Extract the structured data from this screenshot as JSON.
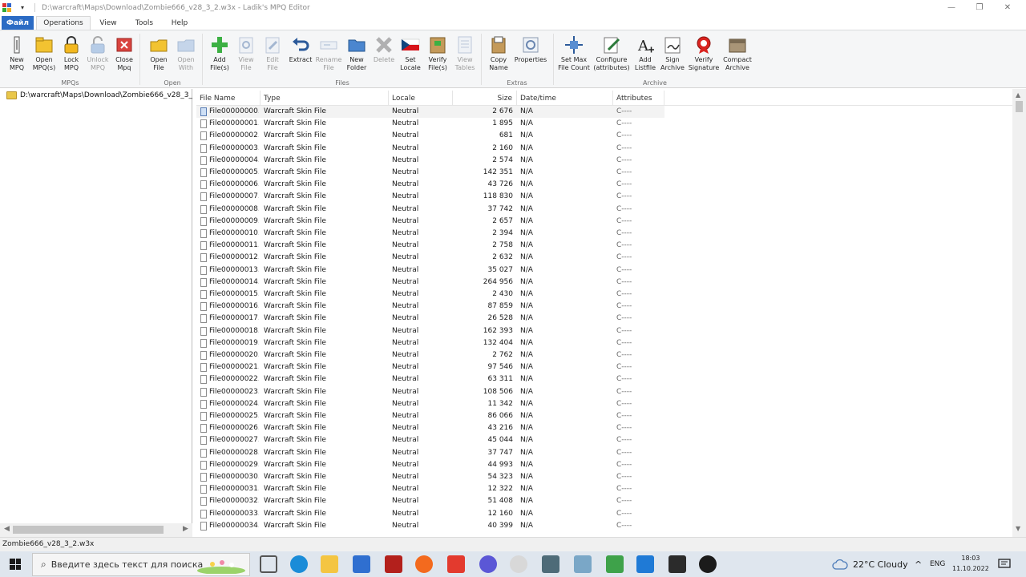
{
  "window": {
    "title": "D:\\warcraft\\Maps\\Download\\Zombie666_v28_3_2.w3x - Ladik's MPQ Editor"
  },
  "tabs": [
    {
      "label": "Файл"
    },
    {
      "label": "Operations"
    },
    {
      "label": "View"
    },
    {
      "label": "Tools"
    },
    {
      "label": "Help"
    }
  ],
  "ribbon": {
    "groups": [
      "MPQs",
      "Open",
      "Files",
      "Extras",
      "Archive"
    ],
    "buttons": [
      {
        "label": "New\nMPQ",
        "icon": "new-mpq-icon",
        "enabled": true
      },
      {
        "label": "Open\nMPQ(s)",
        "icon": "open-mpq-icon",
        "enabled": true
      },
      {
        "label": "Lock\nMPQ",
        "icon": "lock-icon",
        "enabled": true
      },
      {
        "label": "Unlock\nMPQ",
        "icon": "unlock-icon",
        "enabled": false
      },
      {
        "label": "Close\nMpq",
        "icon": "close-mpq-icon",
        "enabled": true
      },
      {
        "label": "Open\nFile",
        "icon": "open-file-icon",
        "enabled": true
      },
      {
        "label": "Open\nWith",
        "icon": "open-with-icon",
        "enabled": false
      },
      {
        "label": "Add\nFile(s)",
        "icon": "add-icon",
        "enabled": true
      },
      {
        "label": "View\nFile",
        "icon": "view-file-icon",
        "enabled": false
      },
      {
        "label": "Edit\nFile",
        "icon": "edit-file-icon",
        "enabled": false
      },
      {
        "label": "Extract",
        "icon": "extract-icon",
        "enabled": true
      },
      {
        "label": "Rename\nFile",
        "icon": "rename-icon",
        "enabled": false
      },
      {
        "label": "New\nFolder",
        "icon": "new-folder-icon",
        "enabled": true
      },
      {
        "label": "Delete",
        "icon": "delete-icon",
        "enabled": false
      },
      {
        "label": "Set\nLocale",
        "icon": "locale-flag-icon",
        "enabled": true
      },
      {
        "label": "Verify\nFile(s)",
        "icon": "verify-file-icon",
        "enabled": true
      },
      {
        "label": "View\nTables",
        "icon": "view-tables-icon",
        "enabled": false
      },
      {
        "label": "Copy\nName",
        "icon": "copy-name-icon",
        "enabled": true
      },
      {
        "label": "Properties",
        "icon": "properties-icon",
        "enabled": true
      },
      {
        "label": "Set Max\nFile Count",
        "icon": "max-file-count-icon",
        "enabled": true
      },
      {
        "label": "Configure\n(attributes)",
        "icon": "configure-icon",
        "enabled": true
      },
      {
        "label": "Add\nListfile",
        "icon": "add-listfile-icon",
        "enabled": true
      },
      {
        "label": "Sign\nArchive",
        "icon": "sign-archive-icon",
        "enabled": true
      },
      {
        "label": "Verify\nSignature",
        "icon": "verify-signature-icon",
        "enabled": true
      },
      {
        "label": "Compact\nArchive",
        "icon": "compact-archive-icon",
        "enabled": true
      }
    ]
  },
  "tree": {
    "root": "D:\\warcraft\\Maps\\Download\\Zombie666_v28_3_"
  },
  "list": {
    "columns": [
      "File Name",
      "Type",
      "Locale",
      "Size",
      "Date/time",
      "Attributes"
    ],
    "rows": [
      [
        "File00000000...",
        "Warcraft Skin File",
        "Neutral",
        "2 676",
        "N/A",
        "C----"
      ],
      [
        "File00000001...",
        "Warcraft Skin File",
        "Neutral",
        "1 895",
        "N/A",
        "C----"
      ],
      [
        "File00000002...",
        "Warcraft Skin File",
        "Neutral",
        "681",
        "N/A",
        "C----"
      ],
      [
        "File00000003...",
        "Warcraft Skin File",
        "Neutral",
        "2 160",
        "N/A",
        "C----"
      ],
      [
        "File00000004...",
        "Warcraft Skin File",
        "Neutral",
        "2 574",
        "N/A",
        "C----"
      ],
      [
        "File00000005...",
        "Warcraft Skin File",
        "Neutral",
        "142 351",
        "N/A",
        "C----"
      ],
      [
        "File00000006...",
        "Warcraft Skin File",
        "Neutral",
        "43 726",
        "N/A",
        "C----"
      ],
      [
        "File00000007...",
        "Warcraft Skin File",
        "Neutral",
        "118 830",
        "N/A",
        "C----"
      ],
      [
        "File00000008...",
        "Warcraft Skin File",
        "Neutral",
        "37 742",
        "N/A",
        "C----"
      ],
      [
        "File00000009...",
        "Warcraft Skin File",
        "Neutral",
        "2 657",
        "N/A",
        "C----"
      ],
      [
        "File00000010...",
        "Warcraft Skin File",
        "Neutral",
        "2 394",
        "N/A",
        "C----"
      ],
      [
        "File00000011...",
        "Warcraft Skin File",
        "Neutral",
        "2 758",
        "N/A",
        "C----"
      ],
      [
        "File00000012...",
        "Warcraft Skin File",
        "Neutral",
        "2 632",
        "N/A",
        "C----"
      ],
      [
        "File00000013...",
        "Warcraft Skin File",
        "Neutral",
        "35 027",
        "N/A",
        "C----"
      ],
      [
        "File00000014...",
        "Warcraft Skin File",
        "Neutral",
        "264 956",
        "N/A",
        "C----"
      ],
      [
        "File00000015...",
        "Warcraft Skin File",
        "Neutral",
        "2 430",
        "N/A",
        "C----"
      ],
      [
        "File00000016...",
        "Warcraft Skin File",
        "Neutral",
        "87 859",
        "N/A",
        "C----"
      ],
      [
        "File00000017...",
        "Warcraft Skin File",
        "Neutral",
        "26 528",
        "N/A",
        "C----"
      ],
      [
        "File00000018...",
        "Warcraft Skin File",
        "Neutral",
        "162 393",
        "N/A",
        "C----"
      ],
      [
        "File00000019...",
        "Warcraft Skin File",
        "Neutral",
        "132 404",
        "N/A",
        "C----"
      ],
      [
        "File00000020...",
        "Warcraft Skin File",
        "Neutral",
        "2 762",
        "N/A",
        "C----"
      ],
      [
        "File00000021...",
        "Warcraft Skin File",
        "Neutral",
        "97 546",
        "N/A",
        "C----"
      ],
      [
        "File00000022...",
        "Warcraft Skin File",
        "Neutral",
        "63 311",
        "N/A",
        "C----"
      ],
      [
        "File00000023...",
        "Warcraft Skin File",
        "Neutral",
        "108 506",
        "N/A",
        "C----"
      ],
      [
        "File00000024...",
        "Warcraft Skin File",
        "Neutral",
        "11 342",
        "N/A",
        "C----"
      ],
      [
        "File00000025...",
        "Warcraft Skin File",
        "Neutral",
        "86 066",
        "N/A",
        "C----"
      ],
      [
        "File00000026...",
        "Warcraft Skin File",
        "Neutral",
        "43 216",
        "N/A",
        "C----"
      ],
      [
        "File00000027...",
        "Warcraft Skin File",
        "Neutral",
        "45 044",
        "N/A",
        "C----"
      ],
      [
        "File00000028...",
        "Warcraft Skin File",
        "Neutral",
        "37 747",
        "N/A",
        "C----"
      ],
      [
        "File00000029...",
        "Warcraft Skin File",
        "Neutral",
        "44 993",
        "N/A",
        "C----"
      ],
      [
        "File00000030...",
        "Warcraft Skin File",
        "Neutral",
        "54 323",
        "N/A",
        "C----"
      ],
      [
        "File00000031...",
        "Warcraft Skin File",
        "Neutral",
        "12 322",
        "N/A",
        "C----"
      ],
      [
        "File00000032...",
        "Warcraft Skin File",
        "Neutral",
        "51 408",
        "N/A",
        "C----"
      ],
      [
        "File00000033...",
        "Warcraft Skin File",
        "Neutral",
        "12 160",
        "N/A",
        "C----"
      ],
      [
        "File00000034...",
        "Warcraft Skin File",
        "Neutral",
        "40 399",
        "N/A",
        "C----"
      ]
    ]
  },
  "statusbar": {
    "text": "Zombie666_v28_3_2.w3x"
  },
  "taskbar": {
    "search_placeholder": "Введите здесь текст для поиска",
    "weather": "22°C  Cloudy",
    "language": "ENG",
    "time": "18:03",
    "date": "11.10.2022"
  },
  "colors": {
    "file_tab": "#2b6bc4",
    "accent_add": "#3cb043",
    "delete": "#8a8a8a"
  }
}
